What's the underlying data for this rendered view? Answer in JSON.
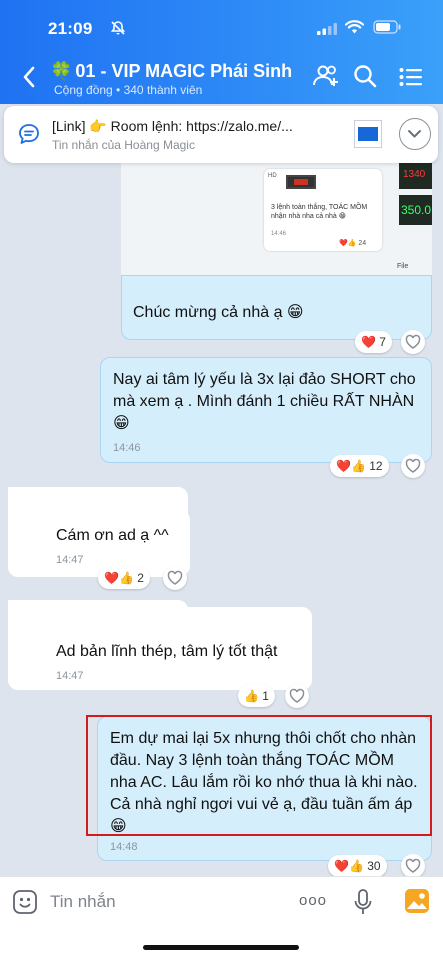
{
  "status": {
    "time": "21:09"
  },
  "header": {
    "group_icon": "🍀",
    "group_name": "01 - VIP MAGIC Phái Sinh",
    "subtitle": "Cộng đồng • 340 thành viên"
  },
  "pinned": {
    "text": "[Link] 👉 Room lệnh: https://zalo.me/...",
    "sender": "Tin nhắn của Hoàng Magic"
  },
  "shot": {
    "caption": "3 lệnh toàn thắng, TOÁC MỒM nhận nhà nha cả nhà 😁",
    "time": "14:46",
    "reaction": "❤️👍 24",
    "price1": "1340",
    "price2": "350.0",
    "file": "File",
    "badge": "HD"
  },
  "messages": [
    {
      "text": "Chúc mừng cả nhà ạ 😁",
      "time": "",
      "reactions": "❤️",
      "count": "7"
    },
    {
      "text": "Nay ai tâm lý yếu là 3x lại đảo SHORT cho mà xem ạ . Mình đánh 1 chiều RẤT NHÀN 😁",
      "time": "14:46",
      "reactions": "❤️👍",
      "count": "12"
    },
    {
      "text": "Cám ơn ad ạ ^^",
      "time": "14:47",
      "reactions": "❤️👍",
      "count": "2"
    },
    {
      "text": "Ad bản lĩnh thép, tâm lý tốt thật",
      "time": "14:47",
      "reactions": "👍",
      "count": "1"
    },
    {
      "text": "Em dự mai lại 5x nhưng thôi chốt cho nhàn đầu. Nay 3 lệnh toàn thắng TOÁC MỒM nha AC. Lâu lắm rồi ko nhớ thua là khi nào. Cả nhà nghỉ ngơi vui vẻ ạ, đầu tuần ấm áp 😁",
      "time": "14:48",
      "reactions": "❤️👍",
      "count": "30"
    }
  ],
  "composer": {
    "placeholder": "Tin nhắn",
    "more": "ooo"
  },
  "colors": {
    "header": "#2a84f5",
    "outgoing_bubble": "#d5eefc",
    "chat_bg": "#dde4ee",
    "highlight": "#d41b1b"
  }
}
